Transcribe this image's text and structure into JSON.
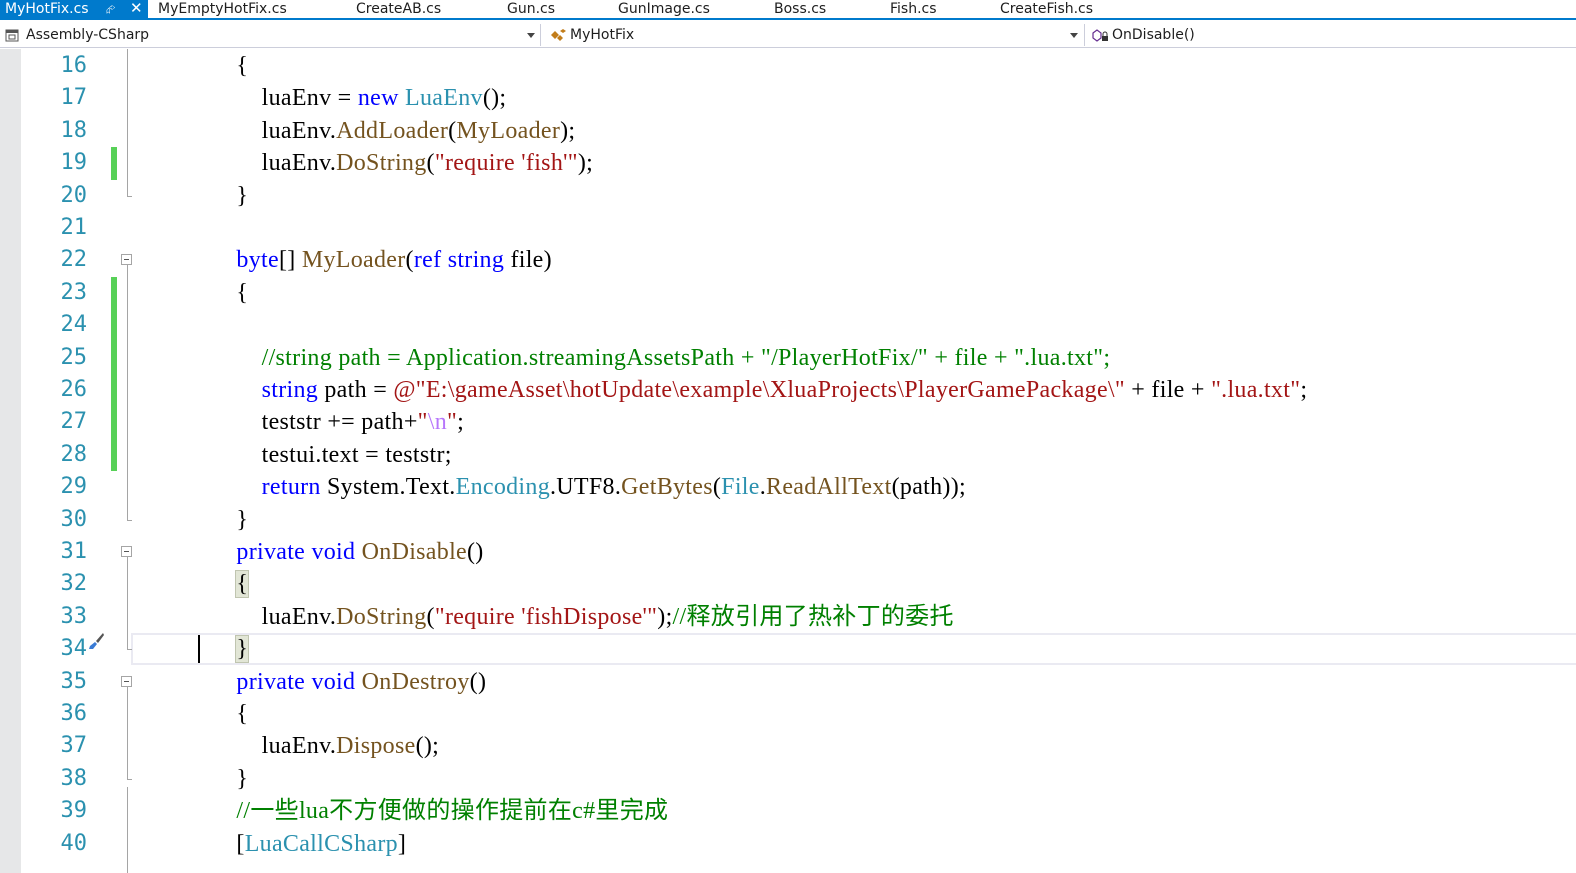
{
  "tabs": [
    {
      "label": "MyHotFix.cs",
      "active": true
    },
    {
      "label": "MyEmptyHotFix.cs"
    },
    {
      "label": "CreateAB.cs"
    },
    {
      "label": "Gun.cs"
    },
    {
      "label": "GunImage.cs"
    },
    {
      "label": "Boss.cs"
    },
    {
      "label": "Fish.cs"
    },
    {
      "label": "CreateFish.cs"
    }
  ],
  "active_tab_icons": {
    "pin": "pin-icon",
    "close": "close-icon"
  },
  "navigation": {
    "project": {
      "label": "Assembly-CSharp",
      "icon": "project-icon"
    },
    "type": {
      "label": "MyHotFix",
      "icon": "class-icon"
    },
    "member": {
      "label": "OnDisable()",
      "icon": "method-icon"
    }
  },
  "colors": {
    "accent": "#007acc",
    "keyword": "#0000ff",
    "type": "#2b91af",
    "method": "#74531f",
    "string": "#a31515",
    "comment": "#008000",
    "line_number": "#2b91af",
    "changed_line": "#57d157"
  },
  "editor": {
    "current_line": "34",
    "changed_lines": [
      "19",
      "23",
      "24",
      "25",
      "26",
      "27",
      "28"
    ],
    "collapsible_lines": [
      "22",
      "31",
      "35"
    ],
    "lines": [
      {
        "n": "16",
        "tokens": [
          [
            "p",
            "        {"
          ]
        ]
      },
      {
        "n": "17",
        "tokens": [
          [
            "p",
            "            luaEnv = "
          ],
          [
            "kw",
            "new"
          ],
          [
            "p",
            " "
          ],
          [
            "ty",
            "LuaEnv"
          ],
          [
            "p",
            "();"
          ]
        ]
      },
      {
        "n": "18",
        "tokens": [
          [
            "p",
            "            luaEnv."
          ],
          [
            "mt",
            "AddLoader"
          ],
          [
            "p",
            "("
          ],
          [
            "mt",
            "MyLoader"
          ],
          [
            "p",
            ");"
          ]
        ]
      },
      {
        "n": "19",
        "tokens": [
          [
            "p",
            "            luaEnv."
          ],
          [
            "mt",
            "DoString"
          ],
          [
            "p",
            "("
          ],
          [
            "st",
            "\"require 'fish'\""
          ],
          [
            "p",
            ");"
          ]
        ]
      },
      {
        "n": "20",
        "tokens": [
          [
            "p",
            "        }"
          ]
        ]
      },
      {
        "n": "21",
        "tokens": []
      },
      {
        "n": "22",
        "tokens": [
          [
            "p",
            "        "
          ],
          [
            "kw",
            "byte"
          ],
          [
            "p",
            "[] "
          ],
          [
            "mt",
            "MyLoader"
          ],
          [
            "p",
            "("
          ],
          [
            "kw",
            "ref"
          ],
          [
            "p",
            " "
          ],
          [
            "kw",
            "string"
          ],
          [
            "p",
            " file)"
          ]
        ]
      },
      {
        "n": "23",
        "tokens": [
          [
            "p",
            "        {"
          ]
        ]
      },
      {
        "n": "24",
        "tokens": []
      },
      {
        "n": "25",
        "tokens": [
          [
            "p",
            "            "
          ],
          [
            "cm",
            "//string path = Application.streamingAssetsPath + \"/PlayerHotFix/\" + file + \".lua.txt\";"
          ]
        ]
      },
      {
        "n": "26",
        "tokens": [
          [
            "p",
            "            "
          ],
          [
            "kw",
            "string"
          ],
          [
            "p",
            " path = "
          ],
          [
            "st",
            "@\"E:\\gameAsset\\hotUpdate\\example\\XluaProjects\\PlayerGamePackage\\\""
          ],
          [
            "p",
            " + file + "
          ],
          [
            "st",
            "\".lua.txt\""
          ],
          [
            "p",
            ";"
          ]
        ]
      },
      {
        "n": "27",
        "tokens": [
          [
            "p",
            "            teststr += path+"
          ],
          [
            "st",
            "\""
          ],
          [
            "es",
            "\\n"
          ],
          [
            "st",
            "\""
          ],
          [
            "p",
            ";"
          ]
        ]
      },
      {
        "n": "28",
        "tokens": [
          [
            "p",
            "            testui.text = teststr;"
          ]
        ]
      },
      {
        "n": "29",
        "tokens": [
          [
            "p",
            "            "
          ],
          [
            "kw",
            "return"
          ],
          [
            "p",
            " System.Text."
          ],
          [
            "ty",
            "Encoding"
          ],
          [
            "p",
            ".UTF8."
          ],
          [
            "mt",
            "GetBytes"
          ],
          [
            "p",
            "("
          ],
          [
            "ty",
            "File"
          ],
          [
            "p",
            "."
          ],
          [
            "mt",
            "ReadAllText"
          ],
          [
            "p",
            "(path));"
          ]
        ]
      },
      {
        "n": "30",
        "tokens": [
          [
            "p",
            "        }"
          ]
        ]
      },
      {
        "n": "31",
        "tokens": [
          [
            "p",
            "        "
          ],
          [
            "kw",
            "private"
          ],
          [
            "p",
            " "
          ],
          [
            "kw",
            "void"
          ],
          [
            "p",
            " "
          ],
          [
            "mt",
            "OnDisable"
          ],
          [
            "p",
            "()"
          ]
        ]
      },
      {
        "n": "32",
        "tokens": [
          [
            "p",
            "        "
          ],
          [
            "hl",
            "{"
          ]
        ]
      },
      {
        "n": "33",
        "tokens": [
          [
            "p",
            "            luaEnv."
          ],
          [
            "mt",
            "DoString"
          ],
          [
            "p",
            "("
          ],
          [
            "st",
            "\"require 'fishDispose'\""
          ],
          [
            "p",
            ");"
          ],
          [
            "cm",
            "//释放引用了热补丁的委托"
          ]
        ]
      },
      {
        "n": "34",
        "tokens": [
          [
            "p",
            "        "
          ],
          [
            "hl",
            "}"
          ]
        ]
      },
      {
        "n": "35",
        "tokens": [
          [
            "p",
            "        "
          ],
          [
            "kw",
            "private"
          ],
          [
            "p",
            " "
          ],
          [
            "kw",
            "void"
          ],
          [
            "p",
            " "
          ],
          [
            "mt",
            "OnDestroy"
          ],
          [
            "p",
            "()"
          ]
        ]
      },
      {
        "n": "36",
        "tokens": [
          [
            "p",
            "        {"
          ]
        ]
      },
      {
        "n": "37",
        "tokens": [
          [
            "p",
            "            luaEnv."
          ],
          [
            "mt",
            "Dispose"
          ],
          [
            "p",
            "();"
          ]
        ]
      },
      {
        "n": "38",
        "tokens": [
          [
            "p",
            "        }"
          ]
        ]
      },
      {
        "n": "39",
        "tokens": [
          [
            "p",
            "        "
          ],
          [
            "cm",
            "//一些lua不方便做的操作提前在c#里完成"
          ]
        ]
      },
      {
        "n": "40",
        "tokens": [
          [
            "p",
            "        ["
          ],
          [
            "ty",
            "LuaCallCSharp"
          ],
          [
            "p",
            "]"
          ]
        ]
      }
    ]
  }
}
